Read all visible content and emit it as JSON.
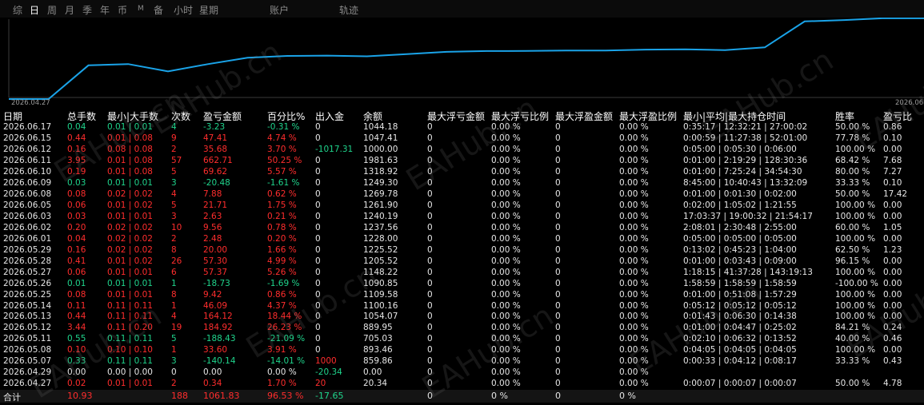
{
  "toolbar": {
    "items": [
      {
        "label": "综",
        "active": false
      },
      {
        "label": "日",
        "active": true
      },
      {
        "label": "周",
        "active": false
      },
      {
        "label": "月",
        "active": false
      },
      {
        "label": "季",
        "active": false
      },
      {
        "label": "年",
        "active": false
      },
      {
        "label": "币",
        "active": false
      },
      {
        "label": "M",
        "active": false
      },
      {
        "label": "备",
        "active": false
      },
      {
        "label": "小时",
        "active": false
      },
      {
        "label": "星期",
        "active": false
      },
      {
        "label": "账户",
        "active": false
      },
      {
        "label": "轨迹",
        "active": false
      }
    ]
  },
  "colors": {
    "line": "#1aa3e8",
    "positive": "#ff2d2d",
    "negative": "#1fd48c",
    "text": "#e6e6e6",
    "header": "#ffffff"
  },
  "chart_data": {
    "type": "line",
    "x_start_label": "2026.04.27",
    "x_end_label": "2026.06.",
    "x": [
      "2026.04.27",
      "2026.04.29",
      "2026.05.07",
      "2026.05.08",
      "2026.05.11",
      "2026.05.12",
      "2026.05.13",
      "2026.05.14",
      "2026.05.25",
      "2026.05.26",
      "2026.05.27",
      "2026.05.28",
      "2026.05.29",
      "2026.06.01",
      "2026.06.02",
      "2026.06.03",
      "2026.06.05",
      "2026.06.08",
      "2026.06.09",
      "2026.06.10",
      "2026.06.11",
      "2026.06.12",
      "2026.06.15",
      "2026.06.17"
    ],
    "values": [
      20.34,
      0.0,
      859.86,
      893.46,
      705.03,
      889.95,
      1054.07,
      1100.16,
      1109.58,
      1090.85,
      1148.22,
      1205.52,
      1225.52,
      1228.0,
      1237.56,
      1240.19,
      1261.9,
      1269.78,
      1249.3,
      1318.92,
      1981.63,
      1000.0,
      1047.41,
      1044.18
    ],
    "equity": [
      20.34,
      20.34,
      880.2,
      913.8,
      725.37,
      910.29,
      1074.41,
      1120.5,
      1129.92,
      1111.19,
      1168.56,
      1225.86,
      1245.86,
      1248.34,
      1257.9,
      1260.53,
      1282.24,
      1290.12,
      1269.64,
      1339.26,
      2001.97,
      2037.65,
      2085.06,
      2081.83
    ]
  },
  "table": {
    "headers": [
      "日期",
      "总手数",
      "最小|大手数",
      "次数",
      "盈亏金额",
      "百分比%",
      "出入金",
      "余额",
      "最大浮亏金额",
      "最大浮亏比例",
      "最大浮盈金额",
      "最大浮盈比例",
      "最小|平均|最大持仓时间",
      "胜率",
      "盈亏比"
    ],
    "rows": [
      {
        "date": "2026.06.17",
        "lots": "0.04",
        "minmax": "0.01 | 0.01",
        "count": "4",
        "pnl": "-3.23",
        "pct": "-0.31 %",
        "flow": "0",
        "balance": "1044.18",
        "maxloss": "0",
        "maxlosspct": "0.00 %",
        "maxprofit": "0",
        "maxprofitpct": "0.00 %",
        "hold": "0:35:17 | 12:32:21 | 27:00:02",
        "win": "50.00 %",
        "ratio": "0.86",
        "sign": "neg"
      },
      {
        "date": "2026.06.15",
        "lots": "0.44",
        "minmax": "0.01 | 0.08",
        "count": "9",
        "pnl": "47.41",
        "pct": "4.74 %",
        "flow": "0",
        "balance": "1047.41",
        "maxloss": "0",
        "maxlosspct": "0.00 %",
        "maxprofit": "0",
        "maxprofitpct": "0.00 %",
        "hold": "0:00:59 | 11:27:38 | 52:01:00",
        "win": "77.78 %",
        "ratio": "0.10",
        "sign": "pos"
      },
      {
        "date": "2026.06.12",
        "lots": "0.16",
        "minmax": "0.08 | 0.08",
        "count": "2",
        "pnl": "35.68",
        "pct": "3.70 %",
        "flow": "-1017.31",
        "balance": "1000.00",
        "maxloss": "0",
        "maxlosspct": "0.00 %",
        "maxprofit": "0",
        "maxprofitpct": "0.00 %",
        "hold": "0:05:00 | 0:05:30 | 0:06:00",
        "win": "100.00 %",
        "ratio": "0.00",
        "sign": "pos"
      },
      {
        "date": "2026.06.11",
        "lots": "3.95",
        "minmax": "0.01 | 0.08",
        "count": "57",
        "pnl": "662.71",
        "pct": "50.25 %",
        "flow": "0",
        "balance": "1981.63",
        "maxloss": "0",
        "maxlosspct": "0.00 %",
        "maxprofit": "0",
        "maxprofitpct": "0.00 %",
        "hold": "0:01:00 | 2:19:29 | 128:30:36",
        "win": "68.42 %",
        "ratio": "7.68",
        "sign": "pos"
      },
      {
        "date": "2026.06.10",
        "lots": "0.19",
        "minmax": "0.01 | 0.08",
        "count": "5",
        "pnl": "69.62",
        "pct": "5.57 %",
        "flow": "0",
        "balance": "1318.92",
        "maxloss": "0",
        "maxlosspct": "0.00 %",
        "maxprofit": "0",
        "maxprofitpct": "0.00 %",
        "hold": "0:01:00 | 7:25:24 | 34:54:30",
        "win": "80.00 %",
        "ratio": "7.27",
        "sign": "pos"
      },
      {
        "date": "2026.06.09",
        "lots": "0.03",
        "minmax": "0.01 | 0.01",
        "count": "3",
        "pnl": "-20.48",
        "pct": "-1.61 %",
        "flow": "0",
        "balance": "1249.30",
        "maxloss": "0",
        "maxlosspct": "0.00 %",
        "maxprofit": "0",
        "maxprofitpct": "0.00 %",
        "hold": "8:45:00 | 10:40:43 | 13:32:09",
        "win": "33.33 %",
        "ratio": "0.10",
        "sign": "neg"
      },
      {
        "date": "2026.06.08",
        "lots": "0.08",
        "minmax": "0.02 | 0.02",
        "count": "4",
        "pnl": "7.88",
        "pct": "0.62 %",
        "flow": "0",
        "balance": "1269.78",
        "maxloss": "0",
        "maxlosspct": "0.00 %",
        "maxprofit": "0",
        "maxprofitpct": "0.00 %",
        "hold": "0:01:00 | 0:01:30 | 0:02:00",
        "win": "50.00 %",
        "ratio": "17.42",
        "sign": "pos"
      },
      {
        "date": "2026.06.05",
        "lots": "0.06",
        "minmax": "0.01 | 0.02",
        "count": "5",
        "pnl": "21.71",
        "pct": "1.75 %",
        "flow": "0",
        "balance": "1261.90",
        "maxloss": "0",
        "maxlosspct": "0.00 %",
        "maxprofit": "0",
        "maxprofitpct": "0.00 %",
        "hold": "0:02:00 | 1:05:02 | 1:21:55",
        "win": "100.00 %",
        "ratio": "0.00",
        "sign": "pos"
      },
      {
        "date": "2026.06.03",
        "lots": "0.03",
        "minmax": "0.01 | 0.01",
        "count": "3",
        "pnl": "2.63",
        "pct": "0.21 %",
        "flow": "0",
        "balance": "1240.19",
        "maxloss": "0",
        "maxlosspct": "0.00 %",
        "maxprofit": "0",
        "maxprofitpct": "0.00 %",
        "hold": "17:03:37 | 19:00:32 | 21:54:17",
        "win": "100.00 %",
        "ratio": "0.00",
        "sign": "pos"
      },
      {
        "date": "2026.06.02",
        "lots": "0.20",
        "minmax": "0.02 | 0.02",
        "count": "10",
        "pnl": "9.56",
        "pct": "0.78 %",
        "flow": "0",
        "balance": "1237.56",
        "maxloss": "0",
        "maxlosspct": "0.00 %",
        "maxprofit": "0",
        "maxprofitpct": "0.00 %",
        "hold": "2:08:01 | 2:30:48 | 2:55:00",
        "win": "60.00 %",
        "ratio": "1.05",
        "sign": "pos"
      },
      {
        "date": "2026.06.01",
        "lots": "0.04",
        "minmax": "0.02 | 0.02",
        "count": "2",
        "pnl": "2.48",
        "pct": "0.20 %",
        "flow": "0",
        "balance": "1228.00",
        "maxloss": "0",
        "maxlosspct": "0.00 %",
        "maxprofit": "0",
        "maxprofitpct": "0.00 %",
        "hold": "0:05:00 | 0:05:00 | 0:05:00",
        "win": "100.00 %",
        "ratio": "0.00",
        "sign": "pos"
      },
      {
        "date": "2026.05.29",
        "lots": "0.16",
        "minmax": "0.02 | 0.02",
        "count": "8",
        "pnl": "20.00",
        "pct": "1.66 %",
        "flow": "0",
        "balance": "1225.52",
        "maxloss": "0",
        "maxlosspct": "0.00 %",
        "maxprofit": "0",
        "maxprofitpct": "0.00 %",
        "hold": "0:13:02 | 0:45:23 | 1:04:00",
        "win": "62.50 %",
        "ratio": "1.23",
        "sign": "pos"
      },
      {
        "date": "2026.05.28",
        "lots": "0.41",
        "minmax": "0.01 | 0.02",
        "count": "26",
        "pnl": "57.30",
        "pct": "4.99 %",
        "flow": "0",
        "balance": "1205.52",
        "maxloss": "0",
        "maxlosspct": "0.00 %",
        "maxprofit": "0",
        "maxprofitpct": "0.00 %",
        "hold": "0:01:00 | 0:03:43 | 0:09:00",
        "win": "96.15 %",
        "ratio": "0.00",
        "sign": "pos"
      },
      {
        "date": "2026.05.27",
        "lots": "0.06",
        "minmax": "0.01 | 0.01",
        "count": "6",
        "pnl": "57.37",
        "pct": "5.26 %",
        "flow": "0",
        "balance": "1148.22",
        "maxloss": "0",
        "maxlosspct": "0.00 %",
        "maxprofit": "0",
        "maxprofitpct": "0.00 %",
        "hold": "1:18:15 | 41:37:28 | 143:19:13",
        "win": "100.00 %",
        "ratio": "0.00",
        "sign": "pos"
      },
      {
        "date": "2026.05.26",
        "lots": "0.01",
        "minmax": "0.01 | 0.01",
        "count": "1",
        "pnl": "-18.73",
        "pct": "-1.69 %",
        "flow": "0",
        "balance": "1090.85",
        "maxloss": "0",
        "maxlosspct": "0.00 %",
        "maxprofit": "0",
        "maxprofitpct": "0.00 %",
        "hold": "1:58:59 | 1:58:59 | 1:58:59",
        "win": "-100.00 %",
        "ratio": "0.00",
        "sign": "neg"
      },
      {
        "date": "2026.05.25",
        "lots": "0.08",
        "minmax": "0.01 | 0.01",
        "count": "8",
        "pnl": "9.42",
        "pct": "0.86 %",
        "flow": "0",
        "balance": "1109.58",
        "maxloss": "0",
        "maxlosspct": "0.00 %",
        "maxprofit": "0",
        "maxprofitpct": "0.00 %",
        "hold": "0:01:00 | 0:51:08 | 1:57:29",
        "win": "100.00 %",
        "ratio": "0.00",
        "sign": "pos"
      },
      {
        "date": "2026.05.14",
        "lots": "0.11",
        "minmax": "0.11 | 0.11",
        "count": "1",
        "pnl": "46.09",
        "pct": "4.37 %",
        "flow": "0",
        "balance": "1100.16",
        "maxloss": "0",
        "maxlosspct": "0.00 %",
        "maxprofit": "0",
        "maxprofitpct": "0.00 %",
        "hold": "0:05:12 | 0:05:12 | 0:05:12",
        "win": "100.00 %",
        "ratio": "0.00",
        "sign": "pos"
      },
      {
        "date": "2026.05.13",
        "lots": "0.44",
        "minmax": "0.11 | 0.11",
        "count": "4",
        "pnl": "164.12",
        "pct": "18.44 %",
        "flow": "0",
        "balance": "1054.07",
        "maxloss": "0",
        "maxlosspct": "0.00 %",
        "maxprofit": "0",
        "maxprofitpct": "0.00 %",
        "hold": "0:01:43 | 0:06:30 | 0:14:38",
        "win": "100.00 %",
        "ratio": "0.00",
        "sign": "pos"
      },
      {
        "date": "2026.05.12",
        "lots": "3.44",
        "minmax": "0.11 | 0.20",
        "count": "19",
        "pnl": "184.92",
        "pct": "26.23 %",
        "flow": "0",
        "balance": "889.95",
        "maxloss": "0",
        "maxlosspct": "0.00 %",
        "maxprofit": "0",
        "maxprofitpct": "0.00 %",
        "hold": "0:01:00 | 0:04:47 | 0:25:02",
        "win": "84.21 %",
        "ratio": "0.24",
        "sign": "pos"
      },
      {
        "date": "2026.05.11",
        "lots": "0.55",
        "minmax": "0.11 | 0.11",
        "count": "5",
        "pnl": "-188.43",
        "pct": "-21.09 %",
        "flow": "0",
        "balance": "705.03",
        "maxloss": "0",
        "maxlosspct": "0.00 %",
        "maxprofit": "0",
        "maxprofitpct": "0.00 %",
        "hold": "0:02:10 | 0:06:32 | 0:13:52",
        "win": "40.00 %",
        "ratio": "0.46",
        "sign": "neg"
      },
      {
        "date": "2026.05.08",
        "lots": "0.10",
        "minmax": "0.10 | 0.10",
        "count": "1",
        "pnl": "33.60",
        "pct": "3.91 %",
        "flow": "0",
        "balance": "893.46",
        "maxloss": "0",
        "maxlosspct": "0.00 %",
        "maxprofit": "0",
        "maxprofitpct": "0.00 %",
        "hold": "0:04:05 | 0:04:05 | 0:04:05",
        "win": "100.00 %",
        "ratio": "0.00",
        "sign": "pos"
      },
      {
        "date": "2026.05.07",
        "lots": "0.33",
        "minmax": "0.11 | 0.11",
        "count": "3",
        "pnl": "-140.14",
        "pct": "-14.01 %",
        "flow": "1000",
        "balance": "859.86",
        "maxloss": "0",
        "maxlosspct": "0.00 %",
        "maxprofit": "0",
        "maxprofitpct": "0.00 %",
        "hold": "0:00:33 | 0:04:12 | 0:08:17",
        "win": "33.33 %",
        "ratio": "0.43",
        "sign": "neg"
      },
      {
        "date": "2026.04.29",
        "lots": "0.00",
        "minmax": "0.00 | 0.00",
        "count": "0",
        "pnl": "0.00",
        "pct": "0.00 %",
        "flow": "-20.34",
        "balance": "0.00",
        "maxloss": "0",
        "maxlosspct": "0.00 %",
        "maxprofit": "0",
        "maxprofitpct": "0.00 %",
        "hold": "",
        "win": "",
        "ratio": "",
        "sign": "zero"
      },
      {
        "date": "2026.04.27",
        "lots": "0.02",
        "minmax": "0.01 | 0.01",
        "count": "2",
        "pnl": "0.34",
        "pct": "1.70 %",
        "flow": "20",
        "balance": "20.34",
        "maxloss": "0",
        "maxlosspct": "0.00 %",
        "maxprofit": "0",
        "maxprofitpct": "0.00 %",
        "hold": "0:00:07 | 0:00:07 | 0:00:07",
        "win": "50.00 %",
        "ratio": "4.78",
        "sign": "pos"
      }
    ],
    "footer": {
      "label": "合计",
      "lots": "10.93",
      "count": "188",
      "pnl": "1061.83",
      "pct": "96.53 %",
      "flow": "-17.65",
      "maxloss": "0",
      "maxlosspct": "0 %",
      "maxprofit": "0",
      "maxprofitpct": "0 %"
    }
  },
  "watermark": "EAHub.cn"
}
